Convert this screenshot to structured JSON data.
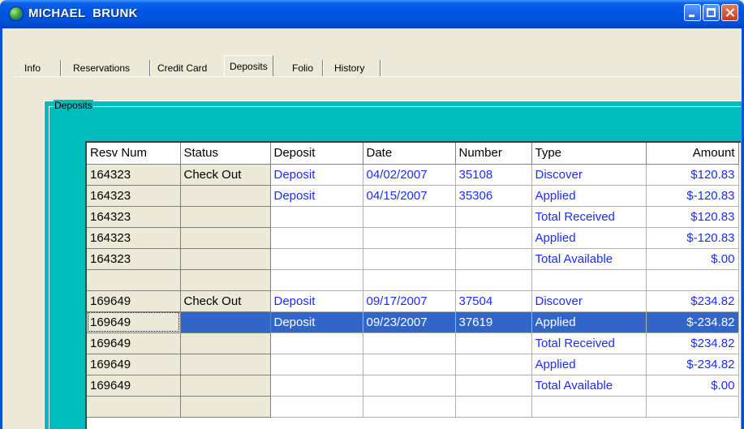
{
  "window": {
    "title": "MICHAEL  BRUNK"
  },
  "tabs": [
    "Info",
    "Reservations",
    "Credit Card",
    "Deposits",
    "Folio",
    "History"
  ],
  "active_tab": "Deposits",
  "group": {
    "label": "Deposits"
  },
  "grid": {
    "columns": [
      "Resv Num",
      "Status",
      "Deposit",
      "Date",
      "Number",
      "Type",
      "Amount"
    ],
    "rows": [
      [
        "164323",
        "Check Out",
        "Deposit",
        "04/02/2007",
        "35108",
        "Discover",
        "$120.83"
      ],
      [
        "164323",
        "",
        "Deposit",
        "04/15/2007",
        "35306",
        "Applied",
        "$-120.83"
      ],
      [
        "164323",
        "",
        "",
        "",
        "",
        "Total Received",
        "$120.83"
      ],
      [
        "164323",
        "",
        "",
        "",
        "",
        "Applied",
        "$-120.83"
      ],
      [
        "164323",
        "",
        "",
        "",
        "",
        "Total Available",
        "$.00"
      ],
      [
        "",
        "",
        "",
        "",
        "",
        "",
        ""
      ],
      [
        "169649",
        "Check Out",
        "Deposit",
        "09/17/2007",
        "37504",
        "Discover",
        "$234.82"
      ],
      [
        "169649",
        "",
        "Deposit",
        "09/23/2007",
        "37619",
        "Applied",
        "$-234.82"
      ],
      [
        "169649",
        "",
        "",
        "",
        "",
        "Total Received",
        "$234.82"
      ],
      [
        "169649",
        "",
        "",
        "",
        "",
        "Applied",
        "$-234.82"
      ],
      [
        "169649",
        "",
        "",
        "",
        "",
        "Total Available",
        "$.00"
      ],
      [
        "",
        "",
        "",
        "",
        "",
        "",
        ""
      ]
    ],
    "selected_row": 7
  },
  "colors": {
    "titlebar": "#0054e3",
    "group_bg": "#00bdbd",
    "selection": "#3166c8",
    "value_text": "#1a2cff"
  },
  "icons": {
    "app": "globe-icon",
    "minimize": "minimize-icon",
    "maximize": "maximize-icon",
    "close": "close-icon"
  }
}
